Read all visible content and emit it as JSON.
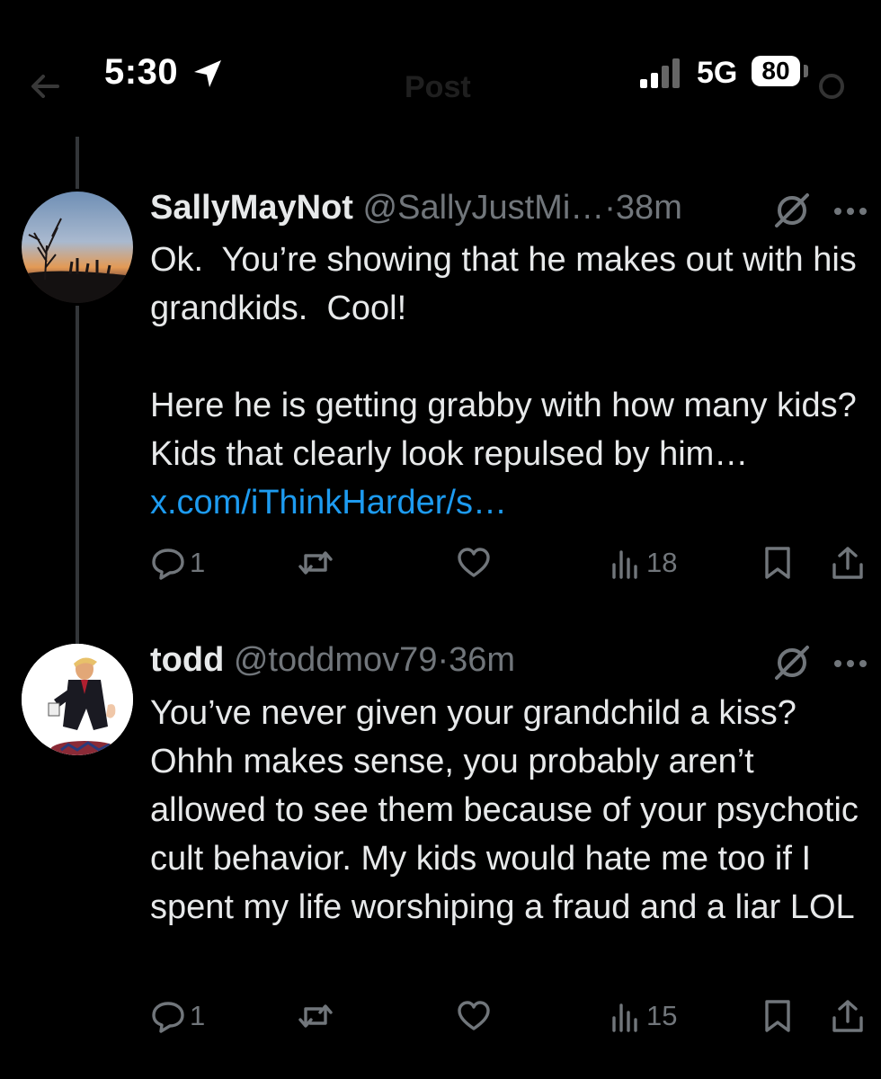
{
  "status_bar": {
    "time": "5:30",
    "network": "5G",
    "battery": "80",
    "header_title": "Post"
  },
  "tweets": [
    {
      "name": "SallyMayNot",
      "handle": "@SallyJustMi…",
      "separator": "·",
      "time": "38m",
      "text": "Ok.  You’re showing that he makes out with his grandkids.  Cool!\n\nHere he is getting grabby with how many kids? Kids that clearly look repulsed by him… ",
      "link": "x.com/iThinkHarder/s…",
      "replies": "1",
      "views": "18"
    },
    {
      "name": "todd",
      "handle": "@toddmov79",
      "separator": "·",
      "time": "36m",
      "text": "You’ve never given your grandchild a kiss? Ohhh makes sense, you probably aren’t allowed to see them because of your psychotic cult behavior. My kids would hate me too if I spent my life worshiping a fraud and a liar LOL",
      "link": "",
      "replies": "1",
      "views": "15"
    }
  ],
  "icons": [
    "location-arrow-icon",
    "signal-icon",
    "grok-icon",
    "more-icon",
    "reply-icon",
    "repost-icon",
    "like-icon",
    "views-icon",
    "bookmark-icon",
    "share-icon"
  ],
  "colors": {
    "background": "#000000",
    "text": "#e7e9ea",
    "muted": "#71767b",
    "link": "#1d9bf0",
    "thread_line": "#333639"
  }
}
